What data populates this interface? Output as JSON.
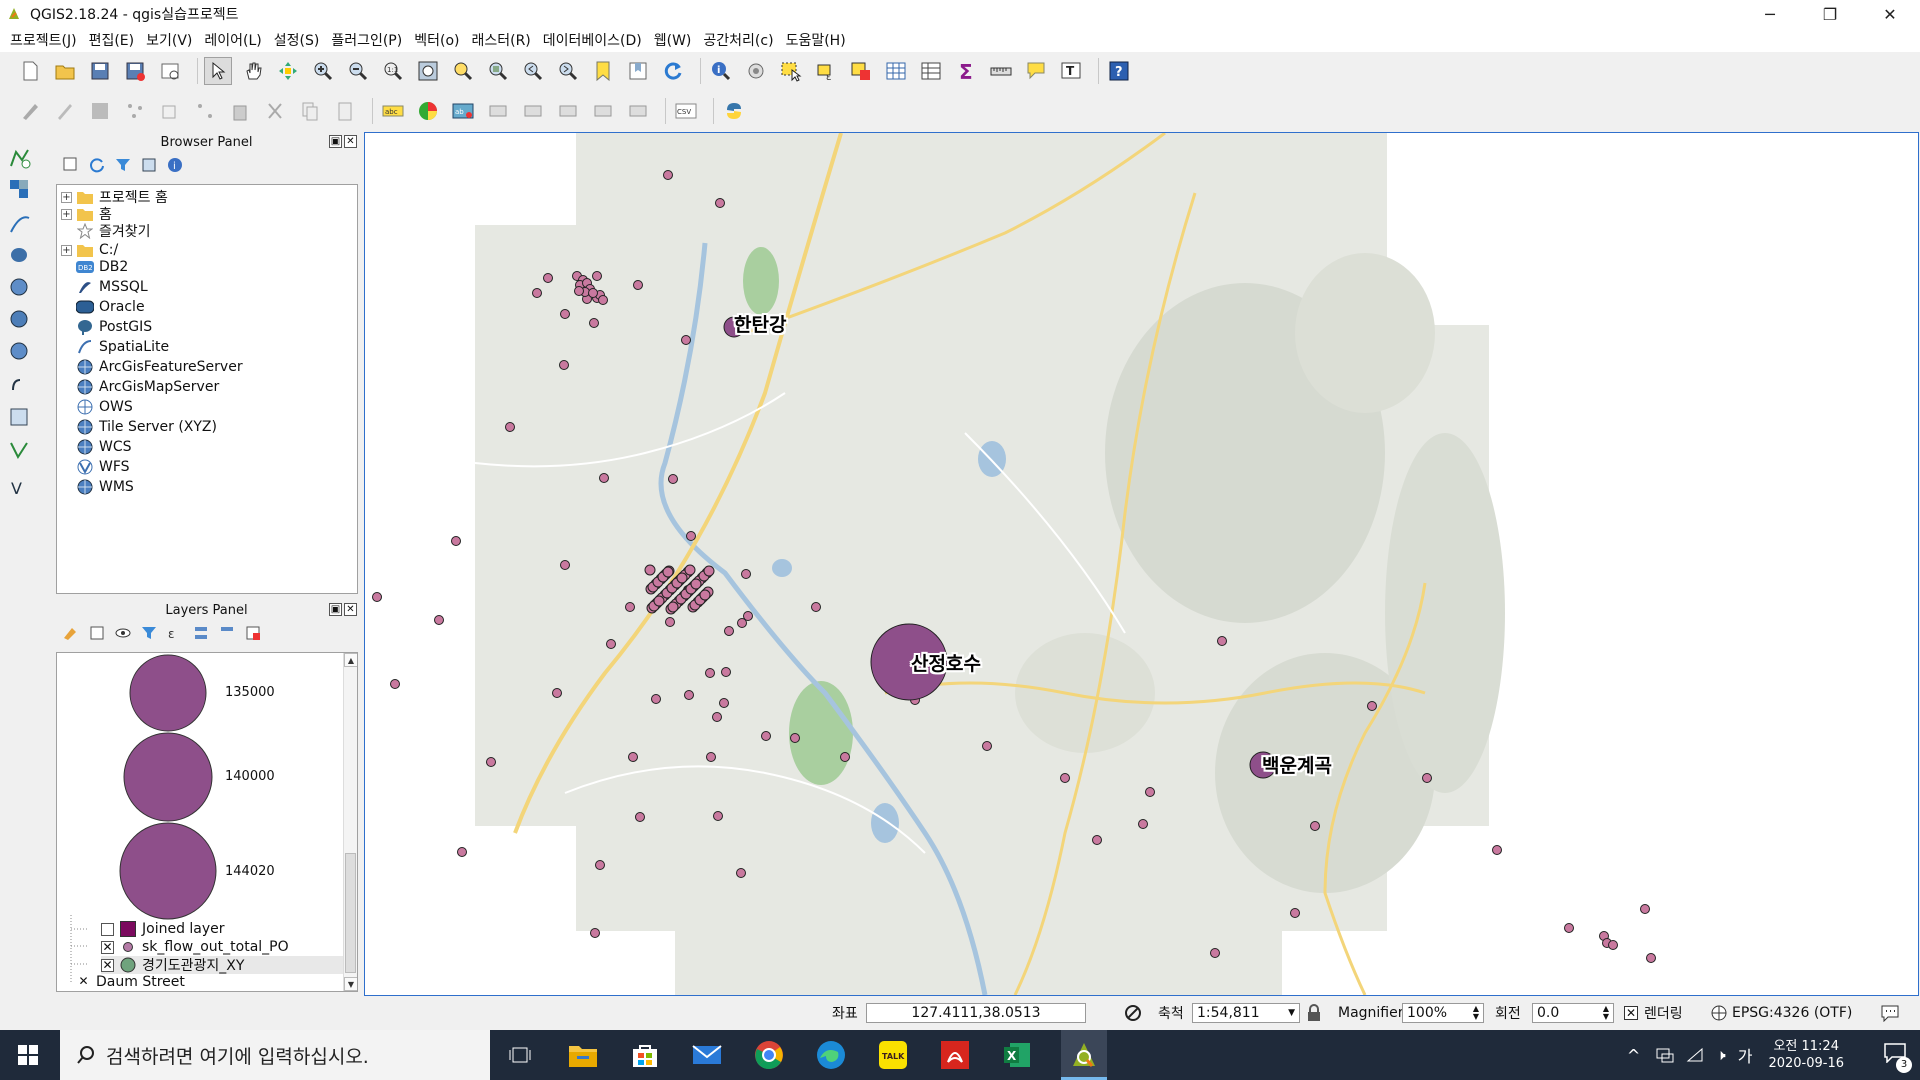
{
  "window": {
    "title": "QGIS2.18.24 - qgis실습프로젝트"
  },
  "menu": [
    "프로젝트(J)",
    "편집(E)",
    "보기(V)",
    "레이어(L)",
    "설정(S)",
    "플러그인(P)",
    "벡터(o)",
    "래스터(R)",
    "데이터베이스(D)",
    "웹(W)",
    "공간처리(c)",
    "도움말(H)"
  ],
  "browser_panel": {
    "title": "Browser Panel",
    "items": [
      {
        "label": "프로젝트 홈",
        "icon": "folder-icon",
        "expandable": true
      },
      {
        "label": "홈",
        "icon": "folder-icon",
        "expandable": true
      },
      {
        "label": "즐겨찾기",
        "icon": "star-icon",
        "expandable": false
      },
      {
        "label": "C:/",
        "icon": "folder-icon",
        "expandable": true
      },
      {
        "label": "DB2",
        "icon": "db2-icon",
        "expandable": false
      },
      {
        "label": "MSSQL",
        "icon": "mssql-icon",
        "expandable": false
      },
      {
        "label": "Oracle",
        "icon": "oracle-icon",
        "expandable": false
      },
      {
        "label": "PostGIS",
        "icon": "postgis-icon",
        "expandable": false
      },
      {
        "label": "SpatiaLite",
        "icon": "spatialite-icon",
        "expandable": false
      },
      {
        "label": "ArcGisFeatureServer",
        "icon": "globe-icon",
        "expandable": false
      },
      {
        "label": "ArcGisMapServer",
        "icon": "globe-icon",
        "expandable": false
      },
      {
        "label": "OWS",
        "icon": "globe-icon",
        "expandable": false
      },
      {
        "label": "Tile Server (XYZ)",
        "icon": "globe-icon",
        "expandable": false
      },
      {
        "label": "WCS",
        "icon": "globe-icon",
        "expandable": false
      },
      {
        "label": "WFS",
        "icon": "globe-icon",
        "expandable": false
      },
      {
        "label": "WMS",
        "icon": "globe-icon",
        "expandable": false
      }
    ]
  },
  "layers_panel": {
    "title": "Layers Panel",
    "legend": [
      {
        "value": "135000"
      },
      {
        "value": "140000"
      },
      {
        "value": "144020"
      }
    ],
    "layers": [
      {
        "name": "Joined layer",
        "checked": false,
        "swatch": "#7b0a5e"
      },
      {
        "name": "sk_flow_out_total_PO",
        "checked": true,
        "swatch": "#b47aa6"
      },
      {
        "name": "경기도관광지_XY",
        "checked": true,
        "swatch": "#6fa37d"
      },
      {
        "name": "Daum Street",
        "checked": true,
        "swatch": ""
      }
    ]
  },
  "map": {
    "labels": [
      "한탄강",
      "산정호수",
      "백운계곡"
    ],
    "point_color": "#c9799f",
    "big_circle_color": "#8e4f8a"
  },
  "statusbar": {
    "coord_label": "좌표",
    "coord_value": "127.4111,38.0513",
    "scale_label": "축척",
    "scale_value": "1:54,811",
    "magnifier_label": "Magnifier",
    "magnifier_value": "100%",
    "rotation_label": "회전",
    "rotation_value": "0.0",
    "render_label": "렌더링",
    "crs": "EPSG:4326 (OTF)"
  },
  "taskbar": {
    "search_placeholder": "검색하려면 여기에 입력하십시오.",
    "time": "오전 11:24",
    "date": "2020-09-16",
    "ime": "가",
    "notification_count": "3"
  }
}
